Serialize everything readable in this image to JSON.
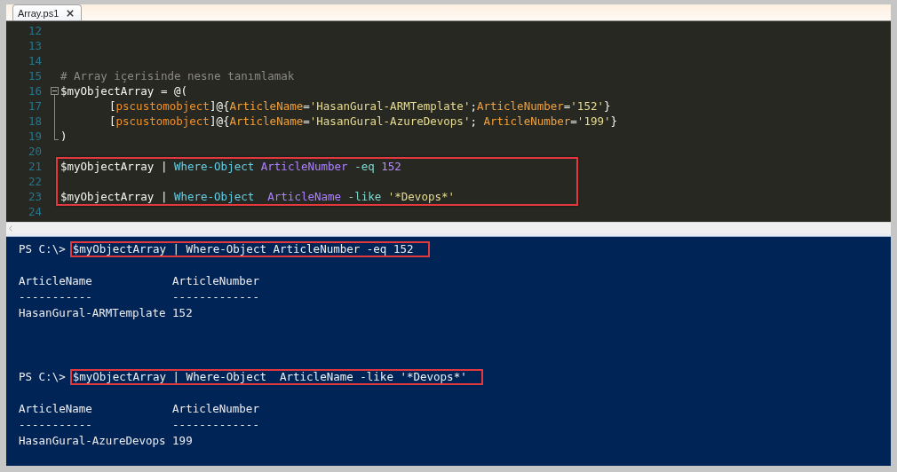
{
  "tabs": [
    {
      "label": "Array.ps1",
      "selected": true
    }
  ],
  "editor": {
    "lines": [
      {
        "number": "12",
        "kind": "plain",
        "highlighted": false
      },
      {
        "number": "13",
        "kind": "plain",
        "highlighted": false
      },
      {
        "number": "14",
        "kind": "plain",
        "highlighted": false
      },
      {
        "number": "15",
        "kind": "plain",
        "highlighted": false,
        "indented": false,
        "tokens": [
          {
            "kind": "comment",
            "text": "# Array içerisinde nesne tanımlamak"
          }
        ]
      },
      {
        "number": "16",
        "kind": "opener",
        "highlighted": false,
        "indented": false,
        "tokens": [
          {
            "kind": "text",
            "text": "$myObjectArray = @("
          }
        ]
      },
      {
        "number": "17",
        "kind": "inner",
        "highlighted": false,
        "indented": true,
        "tokens": [
          {
            "kind": "text",
            "text": "["
          },
          {
            "kind": "type",
            "text": "pscustomobject"
          },
          {
            "kind": "text",
            "text": "]@{"
          },
          {
            "kind": "member",
            "text": "ArticleName"
          },
          {
            "kind": "text",
            "text": "="
          },
          {
            "kind": "string",
            "text": "'HasanGural-ARMTemplate'"
          },
          {
            "kind": "text",
            "text": ";"
          },
          {
            "kind": "member",
            "text": "ArticleNumber"
          },
          {
            "kind": "text",
            "text": "="
          },
          {
            "kind": "string",
            "text": "'152'"
          },
          {
            "kind": "text",
            "text": "}"
          }
        ]
      },
      {
        "number": "18",
        "kind": "inner",
        "highlighted": false,
        "indented": true,
        "tokens": [
          {
            "kind": "text",
            "text": "["
          },
          {
            "kind": "type",
            "text": "pscustomobject"
          },
          {
            "kind": "text",
            "text": "]@{"
          },
          {
            "kind": "member",
            "text": "ArticleName"
          },
          {
            "kind": "text",
            "text": "="
          },
          {
            "kind": "string",
            "text": "'HasanGural-AzureDevops'"
          },
          {
            "kind": "text",
            "text": "; "
          },
          {
            "kind": "member",
            "text": "ArticleNumber"
          },
          {
            "kind": "text",
            "text": "="
          },
          {
            "kind": "string",
            "text": "'199'"
          },
          {
            "kind": "text",
            "text": "}"
          }
        ]
      },
      {
        "number": "19",
        "kind": "closer",
        "highlighted": false,
        "indented": false,
        "tokens": [
          {
            "kind": "text",
            "text": ")"
          }
        ]
      },
      {
        "number": "20",
        "kind": "plain",
        "highlighted": false
      },
      {
        "number": "21",
        "kind": "plain",
        "highlighted": true,
        "indented": false,
        "tokens": [
          {
            "kind": "text",
            "text": "$myObjectArray | "
          },
          {
            "kind": "command",
            "text": "Where-Object "
          },
          {
            "kind": "argument",
            "text": "ArticleNumber "
          },
          {
            "kind": "parameter",
            "text": "-eq "
          },
          {
            "kind": "number",
            "text": "152"
          }
        ]
      },
      {
        "number": "22",
        "kind": "plain",
        "highlighted": true
      },
      {
        "number": "23",
        "kind": "plain",
        "highlighted": true,
        "indented": false,
        "tokens": [
          {
            "kind": "text",
            "text": "$myObjectArray | "
          },
          {
            "kind": "command",
            "text": "Where-Object  "
          },
          {
            "kind": "argument",
            "text": "ArticleName "
          },
          {
            "kind": "parameter",
            "text": "-like "
          },
          {
            "kind": "string",
            "text": "'*Devops*'"
          }
        ]
      },
      {
        "number": "24",
        "kind": "plain",
        "highlighted": false
      }
    ]
  },
  "console": {
    "lines": [
      {
        "kind": "prompt",
        "prompt": "PS C:\\>",
        "command": "$myObjectArray | Where-Object ArticleNumber -eq 152",
        "highlighted": true
      },
      {
        "kind": "blank"
      },
      {
        "kind": "table",
        "columns": [
          "ArticleName",
          "ArticleNumber"
        ],
        "rules": [
          "-----------",
          "-------------"
        ],
        "rows": [
          [
            "HasanGural-ARMTemplate",
            "152"
          ]
        ]
      },
      {
        "kind": "blank"
      },
      {
        "kind": "blank"
      },
      {
        "kind": "blank"
      },
      {
        "kind": "prompt",
        "prompt": "PS C:\\>",
        "command": "$myObjectArray | Where-Object  ArticleName -like '*Devops*'",
        "highlighted": true
      },
      {
        "kind": "blank"
      },
      {
        "kind": "table",
        "columns": [
          "ArticleName",
          "ArticleNumber"
        ],
        "rules": [
          "-----------",
          "-------------"
        ],
        "rows": [
          [
            "HasanGural-AzureDevops",
            "199"
          ]
        ]
      }
    ]
  }
}
